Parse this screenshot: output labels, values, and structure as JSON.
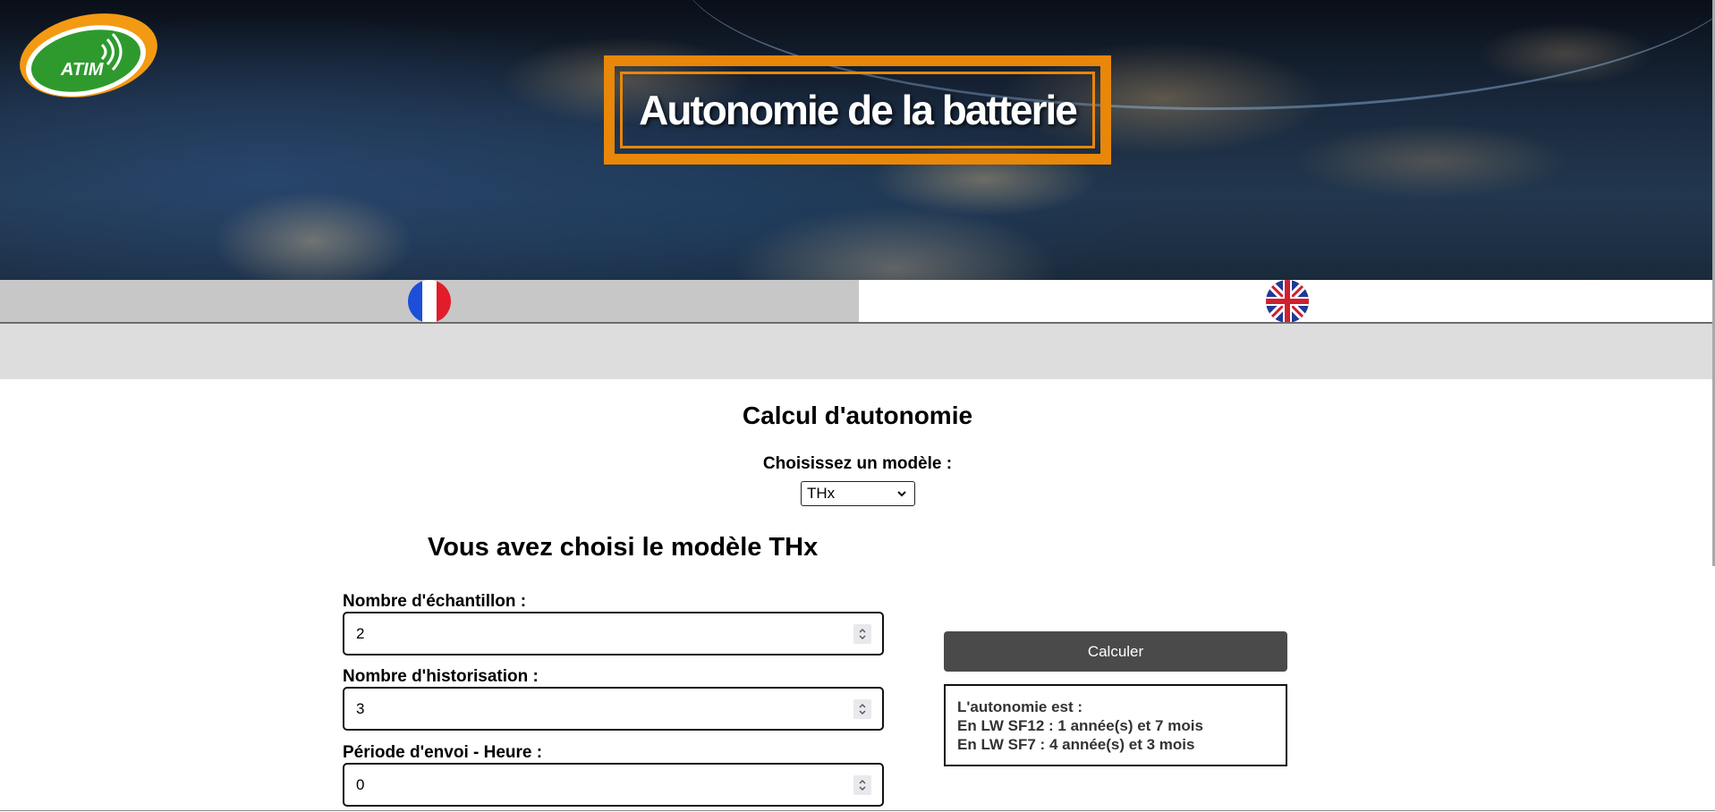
{
  "header": {
    "logo_text": "ATIM",
    "title": "Autonomie de la batterie"
  },
  "language_bar": {
    "french_flag": "flag-fr-icon",
    "english_flag": "flag-uk-icon",
    "active": "fr"
  },
  "main": {
    "title": "Calcul d'autonomie",
    "model_label": "Choisissez un modèle :",
    "model_selected": "THx",
    "chosen_title": "Vous avez choisi le modèle THx"
  },
  "form": {
    "fields": [
      {
        "label": "Nombre d'échantillon :",
        "value": "2"
      },
      {
        "label": "Nombre d'historisation :",
        "value": "3"
      },
      {
        "label": "Période d'envoi - Heure :",
        "value": "0"
      }
    ]
  },
  "actions": {
    "calculate_label": "Calculer"
  },
  "result": {
    "heading": "L'autonomie est :",
    "line_sf12": "En LW SF12 : 1 année(s) et 7 mois",
    "line_sf7": "En LW SF7 : 4 année(s) et 3 mois"
  },
  "colors": {
    "accent_orange": "#e8870a",
    "logo_green": "#2e9a2e",
    "button_dark": "#4a4a4a",
    "lang_active_bg": "#c7c7c7",
    "band_grey": "#dddddd"
  }
}
